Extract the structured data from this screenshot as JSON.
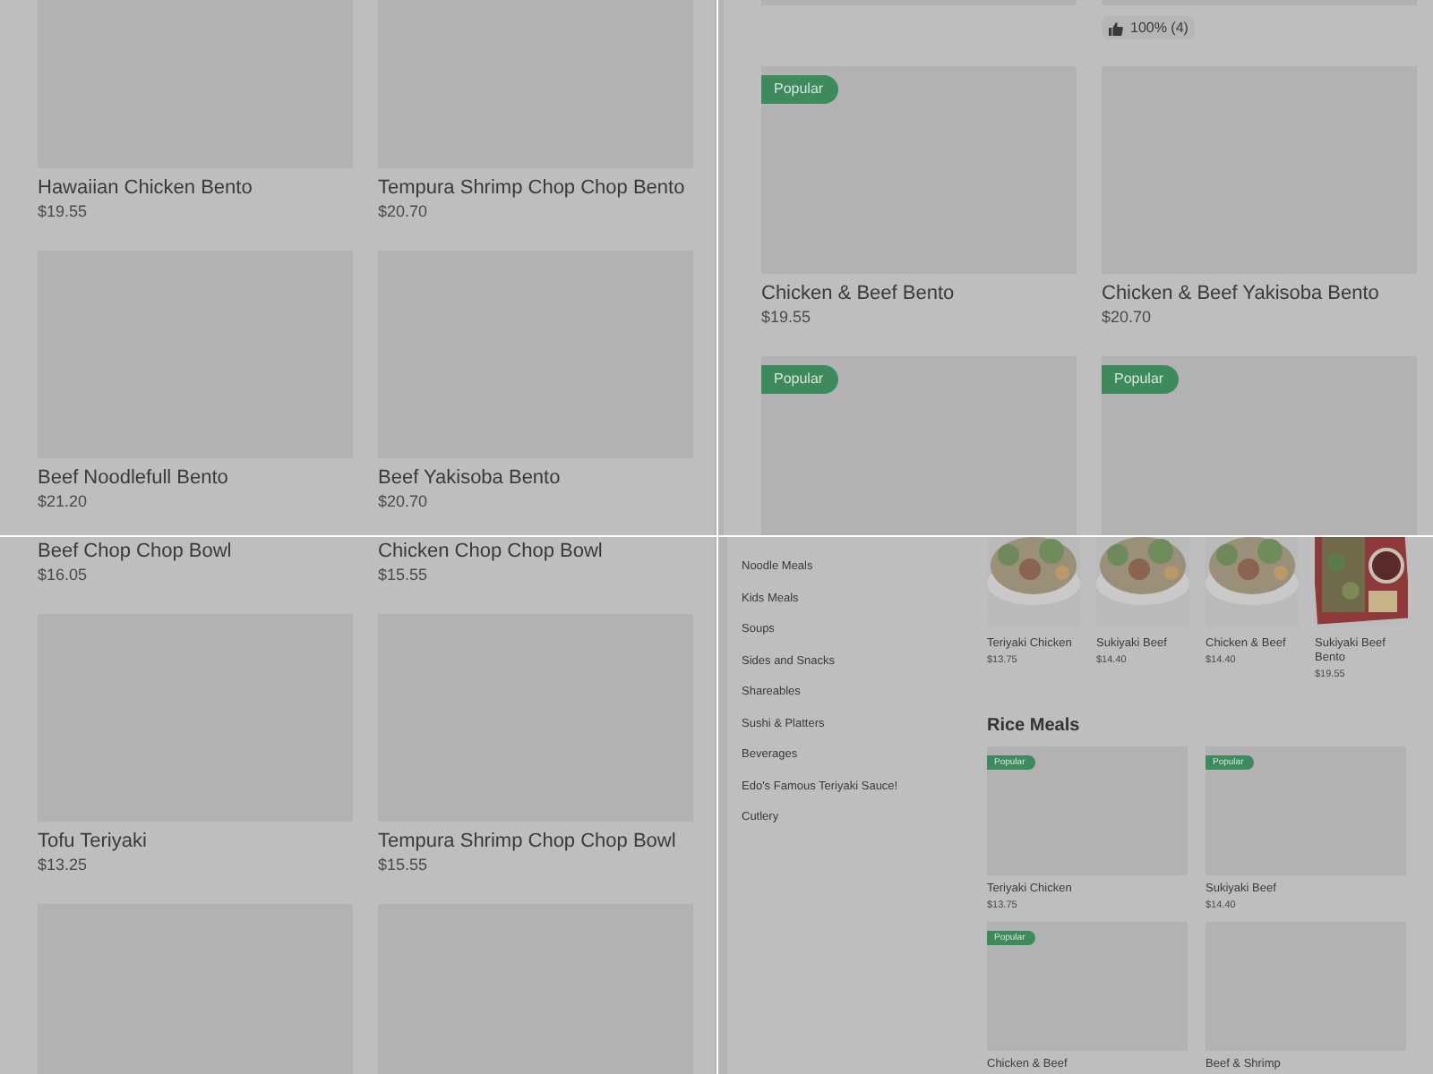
{
  "panels": [
    {
      "kind": "grid",
      "cards": [
        {
          "kind": "product",
          "name": "Hawaiian Chicken Bento",
          "price": "$19.55"
        },
        {
          "kind": "product",
          "name": "Tempura Shrimp Chop Chop Bento",
          "price": "$20.70"
        },
        {
          "kind": "product",
          "name": "Beef Noodlefull Bento",
          "price": "$21.20"
        },
        {
          "kind": "product",
          "name": "Beef Yakisoba Bento",
          "price": "$20.70"
        }
      ]
    },
    {
      "kind": "grid",
      "cards": [
        {
          "kind": "product"
        },
        {
          "kind": "product",
          "rating": "100% (4)"
        },
        {
          "kind": "product",
          "name": "Chicken & Beef Bento",
          "price": "$19.55",
          "badge": "Popular"
        },
        {
          "kind": "product",
          "name": "Chicken & Beef Yakisoba Bento",
          "price": "$20.70"
        },
        {
          "kind": "product",
          "badge": "Popular"
        },
        {
          "kind": "product",
          "badge": "Popular"
        }
      ]
    },
    {
      "kind": "grid",
      "cards": [
        {
          "kind": "product",
          "name": "Beef Chop Chop Bowl",
          "price": "$16.05"
        },
        {
          "kind": "product",
          "name": "Chicken Chop Chop Bowl",
          "price": "$15.55"
        },
        {
          "kind": "product",
          "name": "Tofu Teriyaki",
          "price": "$13.25"
        },
        {
          "kind": "product",
          "name": "Tempura Shrimp Chop Chop Bowl",
          "price": "$15.55"
        },
        {
          "kind": "product"
        },
        {
          "kind": "product"
        }
      ]
    },
    {
      "kind": "menu",
      "categories": [
        "Noodle Meals",
        "Kids Meals",
        "Soups",
        "Sides and Snacks",
        "Shareables",
        "Sushi & Platters",
        "Beverages",
        "Edo's Famous Teriyaki Sauce!",
        "Cutlery"
      ],
      "featured": [
        {
          "name": "Teriyaki Chicken",
          "price": "$13.75",
          "kind": "bowl"
        },
        {
          "name": "Sukiyaki Beef",
          "price": "$14.40",
          "kind": "bowl"
        },
        {
          "name": "Chicken & Beef",
          "price": "$14.40",
          "kind": "bowl"
        },
        {
          "name": "Sukiyaki Beef Bento",
          "price": "$19.55",
          "kind": "bento"
        }
      ],
      "section": "Rice Meals",
      "cards": [
        {
          "name": "Teriyaki Chicken",
          "price": "$13.75",
          "badge": "Popular"
        },
        {
          "name": "Sukiyaki Beef",
          "price": "$14.40",
          "badge": "Popular"
        },
        {
          "name": "Chicken & Beef",
          "badge": "Popular"
        },
        {
          "name": "Beef & Shrimp"
        }
      ]
    }
  ]
}
